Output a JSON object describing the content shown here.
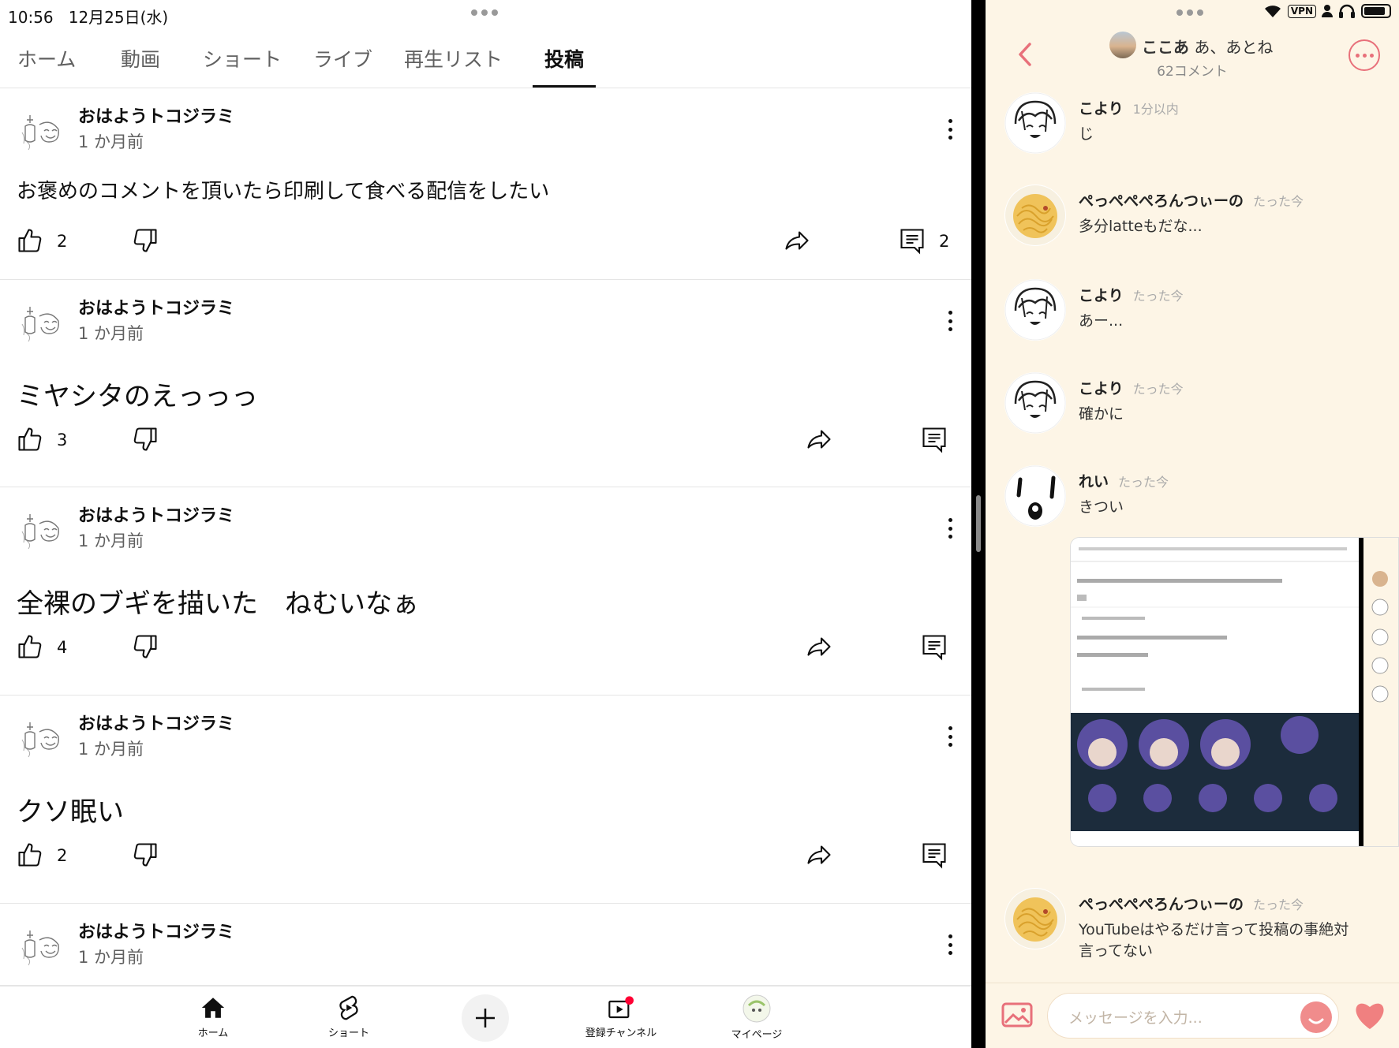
{
  "status_left": {
    "time": "10:56",
    "date": "12月25日(水)"
  },
  "tabs": [
    {
      "label": "ホーム"
    },
    {
      "label": "動画"
    },
    {
      "label": "ショート"
    },
    {
      "label": "ライブ"
    },
    {
      "label": "再生リスト"
    },
    {
      "label": "投稿"
    }
  ],
  "active_tab": "投稿",
  "posts": [
    {
      "channel": "おはようトコジラミ",
      "time": "1 か月前",
      "text": "お褒めのコメントを頂いたら印刷して食べる配信をしたい",
      "likes": "2",
      "comments": "2"
    },
    {
      "channel": "おはようトコジラミ",
      "time": "1 か月前",
      "text": "ミヤシタのえっっっ",
      "likes": "3",
      "comments": ""
    },
    {
      "channel": "おはようトコジラミ",
      "time": "1 か月前",
      "text": "全裸のブギを描いた　ねむいなぁ",
      "likes": "4",
      "comments": ""
    },
    {
      "channel": "おはようトコジラミ",
      "time": "1 か月前",
      "text": "クソ眠い",
      "likes": "2",
      "comments": ""
    },
    {
      "channel": "おはようトコジラミ",
      "time": "1 か月前",
      "text": "",
      "likes": "",
      "comments": ""
    }
  ],
  "bottom_nav": {
    "home": "ホーム",
    "shorts": "ショート",
    "subscriptions": "登録チャンネル",
    "mypage": "マイページ"
  },
  "chat": {
    "status": {
      "vpn": "VPN"
    },
    "room_name": "ここあ",
    "room_members": "あ、あとね",
    "comment_count": "62コメント",
    "messages": [
      {
        "name": "こより",
        "time": "1分以内",
        "text": "じ",
        "avatar": "sketch-face"
      },
      {
        "name": "ぺっぺぺぺろんつぃーの",
        "time": "たった今",
        "text": "多分latteもだな...",
        "avatar": "pasta"
      },
      {
        "name": "こより",
        "time": "たった今",
        "text": "あー...",
        "avatar": "sketch-face"
      },
      {
        "name": "こより",
        "time": "たった今",
        "text": "確かに",
        "avatar": "sketch-face"
      },
      {
        "name": "れい",
        "time": "たった今",
        "text": "きつい",
        "avatar": "simple-face"
      },
      {
        "name": "ぺっぺぺぺろんつぃーの",
        "time": "たった今",
        "text": "YouTubeはやるだけ言って投稿の事絶対\n言ってない",
        "avatar": "pasta"
      }
    ],
    "input_placeholder": "メッセージを入力...",
    "accent": "#e8707a"
  },
  "colors": {
    "yt_text": "#0f0f0f",
    "yt_secondary": "#606060",
    "chat_bg": "#fdf5e6",
    "notification_dot": "#ff0033"
  }
}
